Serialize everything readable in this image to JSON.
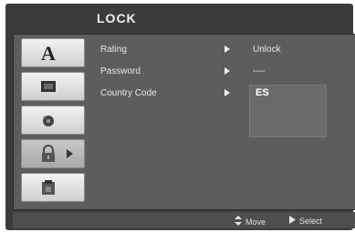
{
  "menu": {
    "title": "LOCK"
  },
  "icons": [
    {
      "name": "language-icon",
      "active": false
    },
    {
      "name": "display-icon",
      "active": false
    },
    {
      "name": "audio-icon",
      "active": false
    },
    {
      "name": "lock-icon",
      "active": true
    },
    {
      "name": "others-icon",
      "active": false
    }
  ],
  "settings": [
    {
      "label": "Rating",
      "value": "Unlock"
    },
    {
      "label": "Password",
      "value": "----"
    },
    {
      "label": "Country Code",
      "value": ""
    }
  ],
  "country_code": {
    "value": "ES"
  },
  "hints": {
    "move": "Move",
    "select": "Select"
  }
}
